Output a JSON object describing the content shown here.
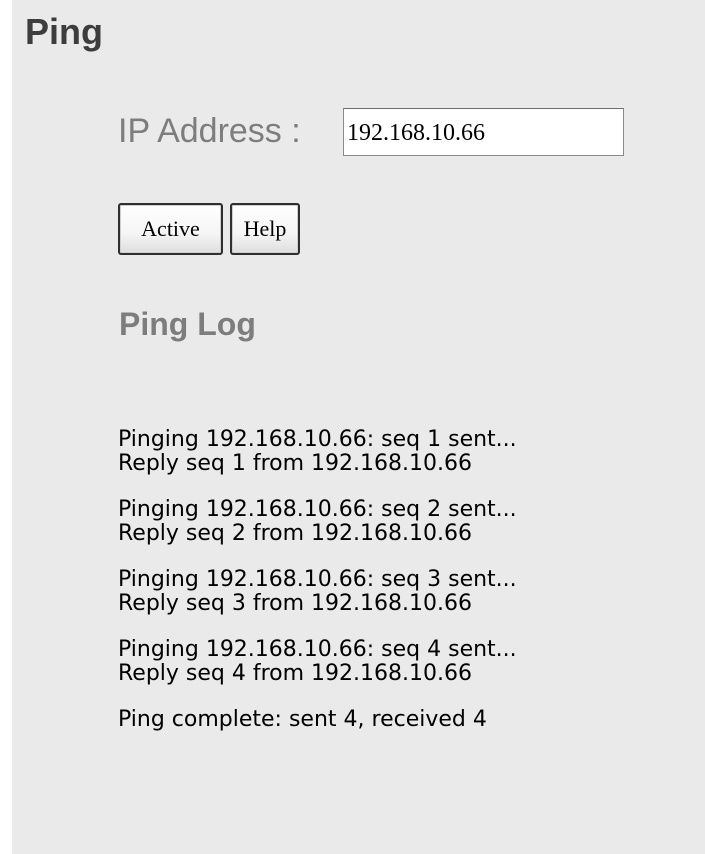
{
  "page": {
    "title": "Ping"
  },
  "ip": {
    "label": "IP Address :",
    "value": "192.168.10.66"
  },
  "buttons": {
    "active": "Active",
    "help": "Help"
  },
  "log": {
    "title": "Ping Log",
    "entries": [
      {
        "sent": "Pinging 192.168.10.66: seq 1 sent...",
        "reply": "Reply seq 1 from 192.168.10.66"
      },
      {
        "sent": "Pinging 192.168.10.66: seq 2 sent...",
        "reply": "Reply seq 2 from 192.168.10.66"
      },
      {
        "sent": "Pinging 192.168.10.66: seq 3 sent...",
        "reply": "Reply seq 3 from 192.168.10.66"
      },
      {
        "sent": "Pinging 192.168.10.66: seq 4 sent...",
        "reply": "Reply seq 4 from 192.168.10.66"
      }
    ],
    "summary": "Ping complete: sent 4, received 4"
  }
}
